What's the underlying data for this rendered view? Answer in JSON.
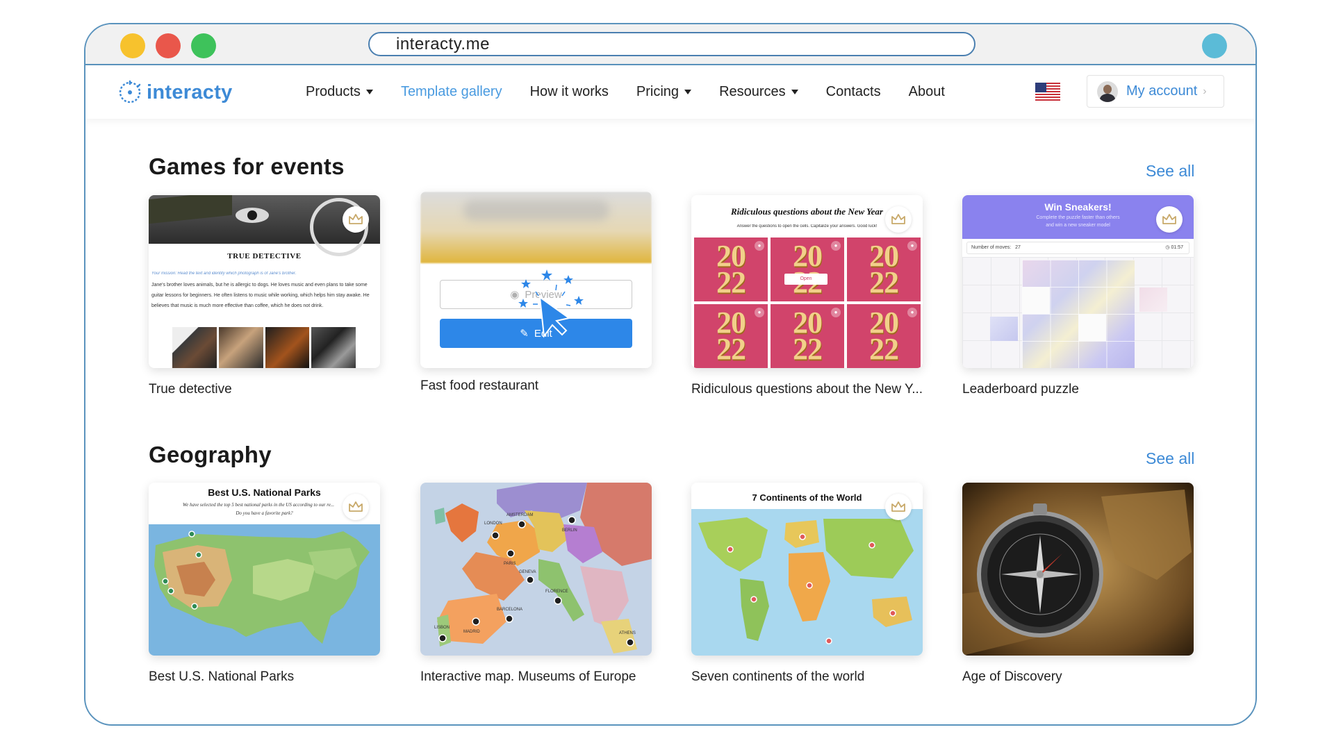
{
  "browser": {
    "url": "interacty.me"
  },
  "nav": {
    "logo_text": "interacty",
    "items": [
      {
        "label": "Products",
        "dropdown": true,
        "active": false
      },
      {
        "label": "Template gallery",
        "dropdown": false,
        "active": true
      },
      {
        "label": "How it works",
        "dropdown": false,
        "active": false
      },
      {
        "label": "Pricing",
        "dropdown": true,
        "active": false
      },
      {
        "label": "Resources",
        "dropdown": true,
        "active": false
      },
      {
        "label": "Contacts",
        "dropdown": false,
        "active": false
      },
      {
        "label": "About",
        "dropdown": false,
        "active": false
      }
    ],
    "language_icon": "us-flag-icon",
    "account_label": "My account"
  },
  "sections": [
    {
      "title": "Games for events",
      "see_all": "See all",
      "cards": [
        {
          "label": "True detective",
          "premium": true
        },
        {
          "label": "Fast food restaurant",
          "premium": false
        },
        {
          "label": "Ridiculous questions about the New Y...",
          "premium": true
        },
        {
          "label": "Leaderboard puzzle",
          "premium": true
        }
      ]
    },
    {
      "title": "Geography",
      "see_all": "See all",
      "cards": [
        {
          "label": "Best U.S. National Parks",
          "premium": true
        },
        {
          "label": "Interactive map. Museums of Europe",
          "premium": false
        },
        {
          "label": "Seven continents of the world",
          "premium": true
        },
        {
          "label": "Age of Discovery",
          "premium": false
        }
      ]
    }
  ],
  "thumbs": {
    "detective": {
      "title": "True Detective",
      "mission": "Your mission: Read the text and identify which photograph is of Jane's brother.",
      "body": "Jane's brother loves animals, but he is allergic to dogs. He loves music and even plans to take some guitar lessons for beginners. He often listens to music while working, which helps him stay awake. He believes that music is much more effective than coffee, which he does not drink."
    },
    "fastfood": {
      "preview_label": "Preview",
      "edit_label": "Edit"
    },
    "newyear": {
      "title": "Ridiculous questions about the New Year",
      "subtitle": "Answer the questions to open the cells. Capitalize your answers. Good luck!",
      "tile_text_top": "20",
      "tile_text_bottom": "22",
      "open_label": "Open"
    },
    "sneakers": {
      "title": "Win Sneakers!",
      "subtitle_1": "Complete the puzzle faster than others",
      "subtitle_2": "and win a new sneaker model",
      "moves_label": "Number of moves:",
      "moves_value": "27",
      "timer": "01:57"
    },
    "parks": {
      "title": "Best U.S. National Parks",
      "subtitle_1": "We have selected the top 5 best national parks in the US according to our re...",
      "subtitle_2": "Do you have a favorite park?"
    },
    "europe": {
      "cities": [
        "AMSTERDAM",
        "LONDON",
        "BERLIN",
        "PARIS",
        "GENEVA",
        "FLORENCE",
        "BARCELONA",
        "MADRID",
        "LISBON",
        "ATHENS"
      ]
    },
    "continents": {
      "title": "7 Continents of the World"
    }
  },
  "colors": {
    "accent": "#3d8ad6",
    "window_border": "#5a93bd",
    "edit_button": "#2d87e8",
    "newyear_tile": "#d1446b",
    "sneaker_header": "#8a82ee"
  }
}
